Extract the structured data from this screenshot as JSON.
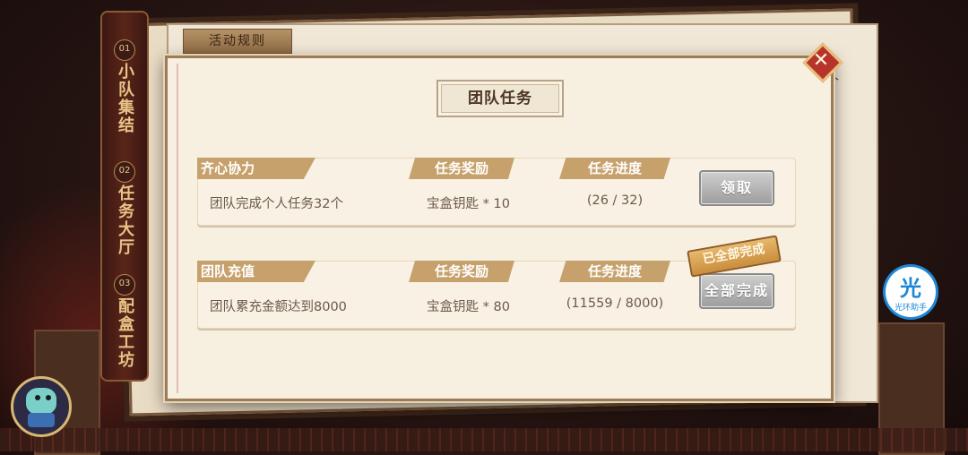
{
  "background": {
    "rule_tab": "活动规则",
    "right_fragment": "个"
  },
  "side_nav": [
    {
      "num": "01",
      "label": "小队集结"
    },
    {
      "num": "02",
      "label": "任务大厅"
    },
    {
      "num": "03",
      "label": "配盒工坊"
    }
  ],
  "panel": {
    "title": "团队任务",
    "close_glyph": "✕"
  },
  "tasks": [
    {
      "name": "齐心协力",
      "reward_header": "任务奖励",
      "progress_header": "任务进度",
      "description": "团队完成个人任务32个",
      "reward": "宝盒钥匙 * 10",
      "progress": "(26 / 32)",
      "button": "领取",
      "stamp": ""
    },
    {
      "name": "团队充值",
      "reward_header": "任务奖励",
      "progress_header": "任务进度",
      "description": "团队累充金额达到8000",
      "reward": "宝盒钥匙 * 80",
      "progress": "(11559 / 8000)",
      "button": "全部完成",
      "stamp": "已全部完成"
    }
  ],
  "helper": {
    "glyph": "光",
    "label": "光环助手"
  },
  "colors": {
    "header_tab": "#c7a16c",
    "close": "#b8342a",
    "helper": "#1e88d6"
  }
}
